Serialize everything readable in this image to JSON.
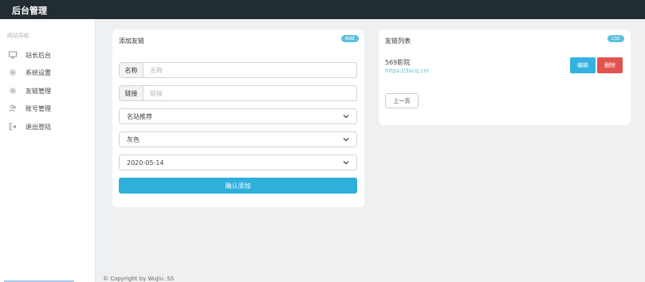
{
  "app": {
    "title": "后台管理"
  },
  "sidebar": {
    "nav_title": "网站导航",
    "items": [
      {
        "label": "站长后台",
        "icon": "monitor-icon"
      },
      {
        "label": "系统设置",
        "icon": "gear-icon"
      },
      {
        "label": "友链管理",
        "icon": "gear-icon"
      },
      {
        "label": "账号管理",
        "icon": "users-icon"
      },
      {
        "label": "退出登陆",
        "icon": "logout-icon"
      }
    ]
  },
  "add_card": {
    "title": "添加友链",
    "badge": "Add",
    "name_field": {
      "label": "名称",
      "placeholder": "名称",
      "value": ""
    },
    "link_field": {
      "label": "链接",
      "placeholder": "链接",
      "value": ""
    },
    "category_select": {
      "value": "名站推荐"
    },
    "color_select": {
      "value": "灰色"
    },
    "date_select": {
      "value": "2020-05-14"
    },
    "submit_label": "确认添加"
  },
  "list_card": {
    "title": "友链列表",
    "badge": "List",
    "items": [
      {
        "name": "569影院",
        "url": "https://3acq.cn/"
      }
    ],
    "edit_label": "编辑",
    "delete_label": "删除",
    "prev_label": "上一页"
  },
  "footer": {
    "copyright": "© Copyright by WuJiu .SS"
  },
  "colors": {
    "topbar": "#222d32",
    "accent": "#2fb0db",
    "danger": "#e0534f",
    "badge": "#5bc0de"
  }
}
